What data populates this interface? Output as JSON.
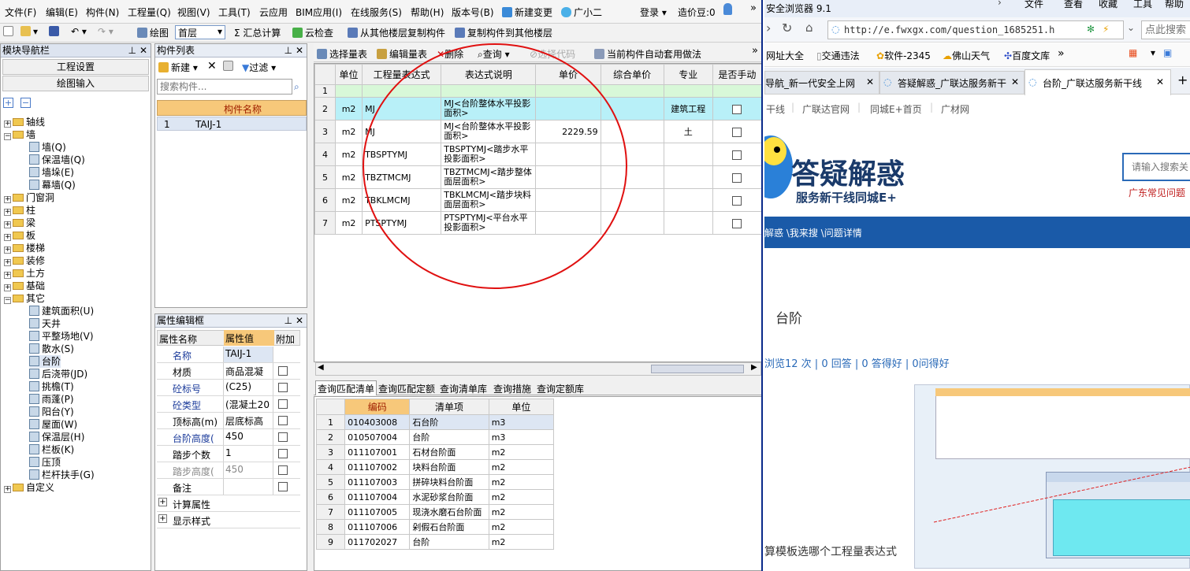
{
  "menu": [
    "文件(F)",
    "编辑(E)",
    "构件(N)",
    "工程量(Q)",
    "视图(V)",
    "工具(T)",
    "云应用",
    "BIM应用(I)",
    "在线服务(S)",
    "帮助(H)",
    "版本号(B)",
    "新建变更",
    "广小二",
    "登录",
    "造价豆:0"
  ],
  "toolbar": {
    "draw": "绘图",
    "floor": "首层",
    "sum": "Σ 汇总计算",
    "cloud_check": "云检查",
    "copy_from": "从其他楼层复制构件",
    "copy_to": "复制构件到其他楼层"
  },
  "nav": {
    "title": "模块导航栏",
    "btn1": "工程设置",
    "btn2": "绘图输入"
  },
  "tree": [
    "轴线",
    "墙",
    "墙(Q)",
    "保温墙(Q)",
    "墙垛(E)",
    "幕墙(Q)",
    "门窗洞",
    "柱",
    "梁",
    "板",
    "楼梯",
    "装修",
    "土方",
    "基础",
    "其它",
    "建筑面积(U)",
    "天井",
    "平整场地(V)",
    "散水(S)",
    "台阶",
    "后浇带(JD)",
    "挑檐(T)",
    "雨蓬(P)",
    "阳台(Y)",
    "屋面(W)",
    "保温层(H)",
    "栏板(K)",
    "压顶",
    "栏杆扶手(G)",
    "自定义"
  ],
  "complist": {
    "title": "构件列表",
    "new": "新建",
    "filter": "过滤",
    "search_placeholder": "搜索构件...",
    "col": "构件名称",
    "rows": [
      [
        "1",
        "TAIJ-1"
      ]
    ]
  },
  "props": {
    "title": "属性编辑框",
    "cols": [
      "属性名称",
      "属性值",
      "附加"
    ],
    "rows": [
      [
        "名称",
        "TAIJ-1"
      ],
      [
        "材质",
        "商品混凝"
      ],
      [
        "砼标号",
        "(C25)"
      ],
      [
        "砼类型",
        "(混凝土20"
      ],
      [
        "顶标高(m)",
        "层底标高"
      ],
      [
        "台阶高度(",
        "450"
      ],
      [
        "踏步个数",
        "1"
      ],
      [
        "踏步高度(",
        "450"
      ],
      [
        "备注",
        ""
      ],
      [
        "计算属性",
        ""
      ],
      [
        "显示样式",
        ""
      ]
    ]
  },
  "qtoolbar": {
    "select": "选择量表",
    "edit": "编辑量表",
    "delete": "删除",
    "query": "查询",
    "code": "选择代码",
    "auto": "当前构件自动套用做法"
  },
  "qtable": {
    "cols": [
      "单位",
      "工程量表达式",
      "表达式说明",
      "单价",
      "综合单价",
      "专业",
      "是否手动"
    ],
    "rows": [
      [
        "1",
        "",
        "",
        "",
        "",
        "",
        "",
        ""
      ],
      [
        "2",
        "m2",
        "MJ",
        "MJ<台阶整体水平投影面积>",
        "",
        "",
        "建筑工程",
        ""
      ],
      [
        "3",
        "m2",
        "MJ",
        "MJ<台阶整体水平投影面积>",
        "2229.59",
        "",
        "土",
        ""
      ],
      [
        "4",
        "m2",
        "TBSPTYMJ",
        "TBSPTYMJ<踏步水平投影面积>",
        "",
        "",
        "",
        ""
      ],
      [
        "5",
        "m2",
        "TBZTMCMJ",
        "TBZTMCMJ<踏步整体面层面积>",
        "",
        "",
        "",
        ""
      ],
      [
        "6",
        "m2",
        "TBKLMCMJ",
        "TBKLMCMJ<踏步块料面层面积>",
        "",
        "",
        "",
        ""
      ],
      [
        "7",
        "m2",
        "PTSPTYMJ",
        "PTSPTYMJ<平台水平投影面积>",
        "",
        "",
        "",
        ""
      ]
    ]
  },
  "btabs": [
    "查询匹配清单",
    "查询匹配定额",
    "查询清单库",
    "查询措施",
    "查询定额库"
  ],
  "btable": {
    "cols": [
      "编码",
      "清单项",
      "单位"
    ],
    "rows": [
      [
        "1",
        "010403008",
        "石台阶",
        "m3"
      ],
      [
        "2",
        "010507004",
        "台阶",
        "m3"
      ],
      [
        "3",
        "011107001",
        "石材台阶面",
        "m2"
      ],
      [
        "4",
        "011107002",
        "块料台阶面",
        "m2"
      ],
      [
        "5",
        "011107003",
        "拼碎块料台阶面",
        "m2"
      ],
      [
        "6",
        "011107004",
        "水泥砂浆台阶面",
        "m2"
      ],
      [
        "7",
        "011107005",
        "现浇水磨石台阶面",
        "m2"
      ],
      [
        "8",
        "011107006",
        "剁假石台阶面",
        "m2"
      ],
      [
        "9",
        "011702027",
        "台阶",
        "m2"
      ]
    ]
  },
  "browser": {
    "title": "安全浏览器 9.1",
    "menu": [
      "文件",
      "查看",
      "收藏",
      "工具",
      "帮助"
    ],
    "url": "http://e.fwxgx.com/question_1685251.h",
    "search_placeholder": "点此搜索",
    "bookmarks": [
      "网址大全",
      "交通违法",
      "软件-2345",
      "佛山天气",
      "百度文库"
    ],
    "tabs": [
      "导航_新一代安全上网",
      "答疑解惑_广联达服务新干",
      "台阶_广联达服务新干线"
    ],
    "sublinks": [
      "干线",
      "广联达官网",
      "同城E+首页",
      "广材网"
    ],
    "logo_main": "答疑解惑",
    "logo_sub": "服务新干线同城E+",
    "site_search": "请输入搜索关",
    "region": "广东常见问题",
    "breadcrumb": "解惑 \\我来搜 \\问题详情",
    "q_title": "台阶",
    "stats": "浏览12 次 | 0 回答 | 0 答得好 | 0问得好",
    "q_text": "算模板选哪个工程量表达式"
  }
}
